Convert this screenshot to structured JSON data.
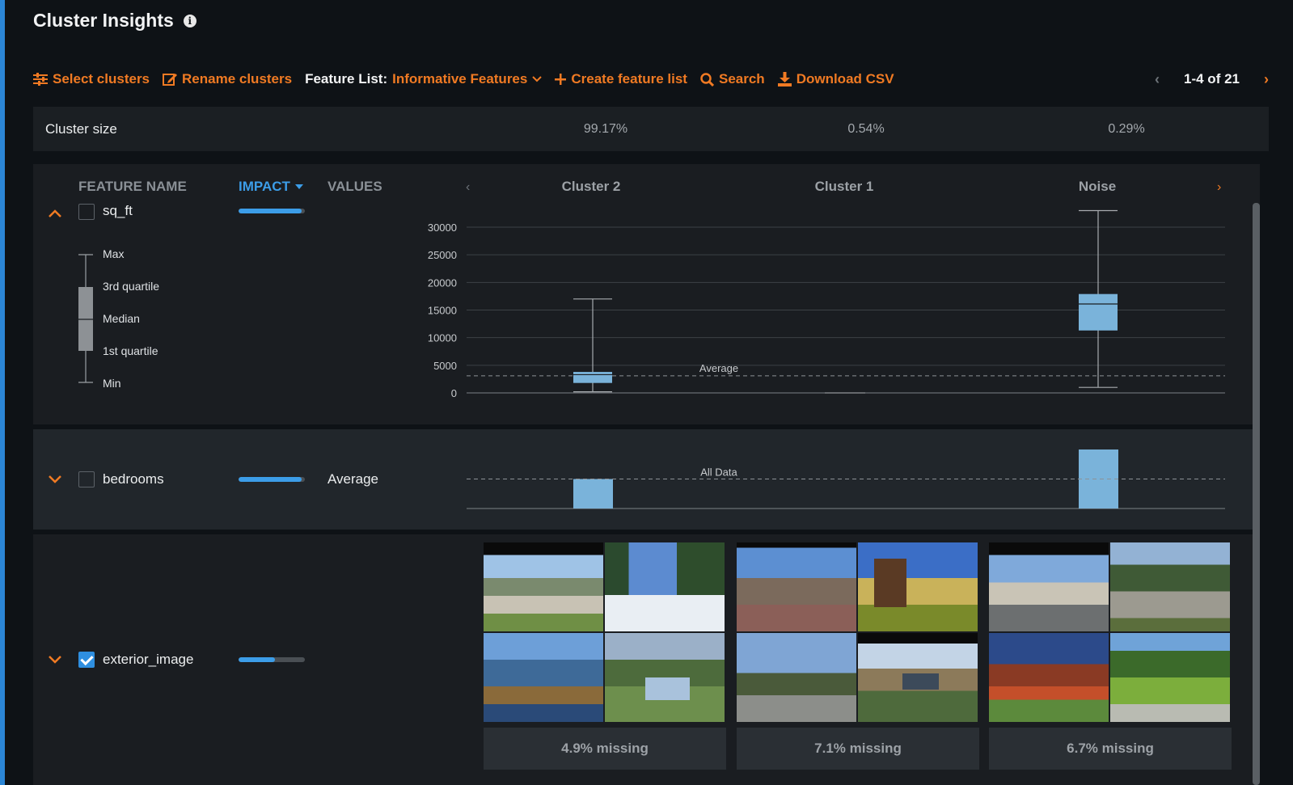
{
  "header": {
    "title": "Cluster Insights"
  },
  "toolbar": {
    "select_clusters": "Select clusters",
    "rename_clusters": "Rename clusters",
    "feature_list_label": "Feature List:",
    "feature_list_value": "Informative Features",
    "create_feature_list": "Create feature list",
    "search": "Search",
    "download_csv": "Download CSV",
    "pager_text": "1-4 of 21"
  },
  "cluster_size": {
    "label": "Cluster size",
    "values": [
      "99.17%",
      "0.54%",
      "0.29%"
    ]
  },
  "table": {
    "headers": {
      "feature_name": "FEATURE NAME",
      "impact": "IMPACT",
      "values": "VALUES"
    },
    "columns": [
      "Cluster 2",
      "Cluster 1",
      "Noise"
    ]
  },
  "legend": {
    "max": "Max",
    "q3": "3rd quartile",
    "median": "Median",
    "q1": "1st quartile",
    "min": "Min"
  },
  "rows": [
    {
      "name": "sq_ft",
      "checked": false,
      "impact": 0.95,
      "values_label": "",
      "expanded": true
    },
    {
      "name": "bedrooms",
      "checked": false,
      "impact": 0.95,
      "values_label": "Average",
      "expanded": false
    },
    {
      "name": "exterior_image",
      "checked": true,
      "impact": 0.55,
      "values_label": "",
      "expanded": false
    }
  ],
  "chart_data": [
    {
      "type": "box",
      "feature": "sq_ft",
      "categories": [
        "Cluster 2",
        "Cluster 1",
        "Noise"
      ],
      "yticks": [
        0,
        5000,
        10000,
        15000,
        20000,
        25000,
        30000
      ],
      "ylim": [
        0,
        30000
      ],
      "average_label": "Average",
      "average": 3100,
      "boxes": [
        {
          "name": "Cluster 2",
          "min": 200,
          "q1": 1800,
          "median": 3300,
          "q3": 3800,
          "max": 17000
        },
        {
          "name": "Cluster 1",
          "min": 0,
          "q1": 0,
          "median": 0,
          "q3": 0,
          "max": 0
        },
        {
          "name": "Noise",
          "min": 1000,
          "q1": 11300,
          "median": 16100,
          "q3": 17900,
          "max": 33000
        }
      ]
    },
    {
      "type": "bar",
      "feature": "bedrooms",
      "categories": [
        "Cluster 2",
        "Cluster 1",
        "Noise"
      ],
      "reference_label": "All Data",
      "values": [
        1.0,
        0,
        2.0
      ],
      "reference": 1.0
    }
  ],
  "images": {
    "missing": [
      "4.9% missing",
      "7.1% missing",
      "6.7% missing"
    ]
  },
  "colors": {
    "accent": "#f07a23",
    "impact": "#3c9de8",
    "box": "#7ab3da",
    "brand_bar": "#2b86d6"
  }
}
